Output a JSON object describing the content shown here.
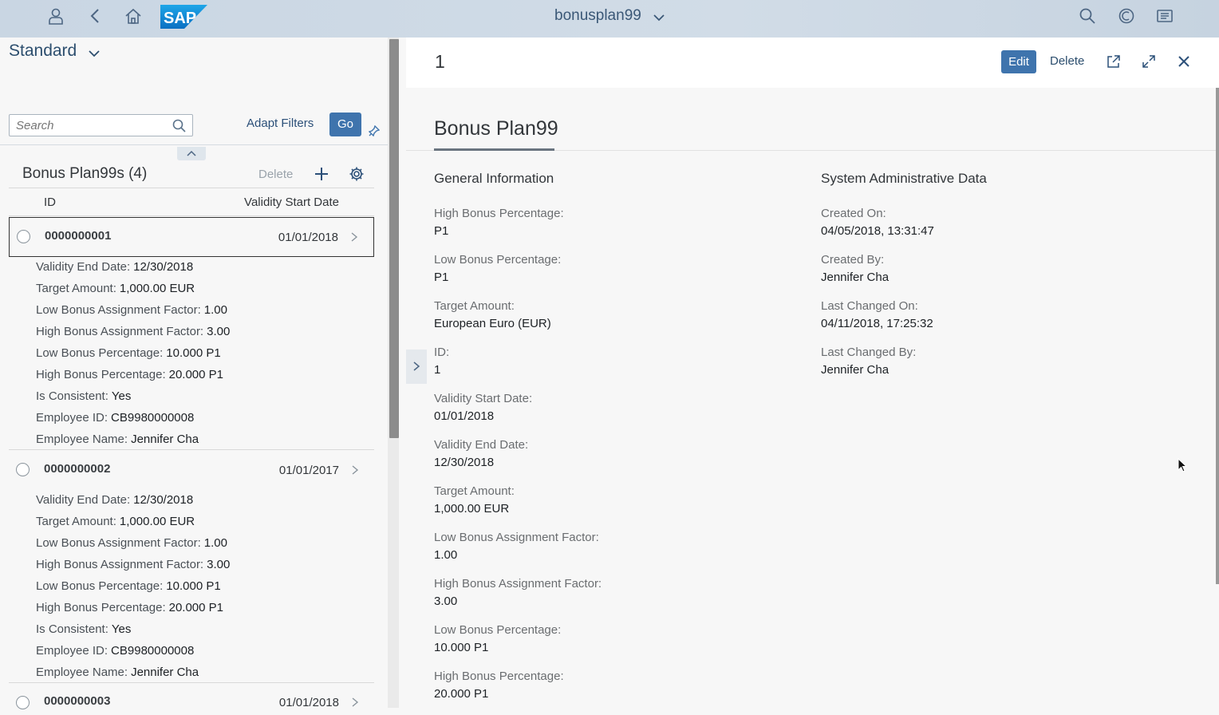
{
  "shell": {
    "title": "bonusplan99",
    "logo_text": "SAP",
    "icons": [
      "user-icon",
      "back-icon",
      "home-icon",
      "search-icon",
      "copilot-icon",
      "notifications-icon"
    ]
  },
  "left": {
    "variant": "Standard",
    "search_placeholder": "Search",
    "adapt_filters": "Adapt Filters",
    "go": "Go",
    "table_title": "Bonus Plan99s (4)",
    "delete": "Delete",
    "col_id": "ID",
    "col_date": "Validity Start Date",
    "rows": [
      {
        "id": "0000000001",
        "date": "01/01/2018",
        "attrs": [
          {
            "k": "Validity End Date:",
            "v": "12/30/2018"
          },
          {
            "k": "Target Amount:",
            "v": "1,000.00  EUR"
          },
          {
            "k": "Low Bonus Assignment Factor:",
            "v": "1.00"
          },
          {
            "k": "High Bonus Assignment Factor:",
            "v": "3.00"
          },
          {
            "k": "Low Bonus Percentage:",
            "v": "10.000  P1"
          },
          {
            "k": "High Bonus Percentage:",
            "v": "20.000  P1"
          },
          {
            "k": "Is Consistent:",
            "v": "Yes"
          },
          {
            "k": "Employee ID:",
            "v": "CB9980000008"
          },
          {
            "k": "Employee Name:",
            "v": "Jennifer Cha"
          }
        ]
      },
      {
        "id": "0000000002",
        "date": "01/01/2017",
        "attrs": [
          {
            "k": "Validity End Date:",
            "v": "12/30/2018"
          },
          {
            "k": "Target Amount:",
            "v": "1,000.00  EUR"
          },
          {
            "k": "Low Bonus Assignment Factor:",
            "v": "1.00"
          },
          {
            "k": "High Bonus Assignment Factor:",
            "v": "3.00"
          },
          {
            "k": "Low Bonus Percentage:",
            "v": "10.000  P1"
          },
          {
            "k": "High Bonus Percentage:",
            "v": "20.000  P1"
          },
          {
            "k": "Is Consistent:",
            "v": "Yes"
          },
          {
            "k": "Employee ID:",
            "v": "CB9980000008"
          },
          {
            "k": "Employee Name:",
            "v": "Jennifer Cha"
          }
        ]
      },
      {
        "id": "0000000003",
        "date": "01/01/2018",
        "attrs": []
      }
    ]
  },
  "right": {
    "object_number": "1",
    "edit": "Edit",
    "delete": "Delete",
    "section_title": "Bonus Plan99",
    "general_title": "General Information",
    "admin_title": "System Administrative Data",
    "general_fields": [
      {
        "label": "High Bonus Percentage:",
        "value": "P1"
      },
      {
        "label": "Low Bonus Percentage:",
        "value": "P1"
      },
      {
        "label": "Target Amount:",
        "value": "European Euro (EUR)"
      },
      {
        "label": "ID:",
        "value": "1"
      },
      {
        "label": "Validity Start Date:",
        "value": "01/01/2018"
      },
      {
        "label": "Validity End Date:",
        "value": "12/30/2018"
      },
      {
        "label": "Target Amount:",
        "value": "1,000.00  EUR"
      },
      {
        "label": "Low Bonus Assignment Factor:",
        "value": "1.00"
      },
      {
        "label": "High Bonus Assignment Factor:",
        "value": "3.00"
      },
      {
        "label": "Low Bonus Percentage:",
        "value": "10.000 P1"
      },
      {
        "label": "High Bonus Percentage:",
        "value": "20.000 P1"
      }
    ],
    "admin_fields": [
      {
        "label": "Created On:",
        "value": "04/05/2018, 13:31:47"
      },
      {
        "label": "Created By:",
        "value": "Jennifer Cha"
      },
      {
        "label": "Last Changed On:",
        "value": "04/11/2018, 17:25:32"
      },
      {
        "label": "Last Changed By:",
        "value": "Jennifer Cha"
      }
    ]
  },
  "colors": {
    "shell_bg": "#c9d6e3",
    "accent": "#3f74ad"
  }
}
